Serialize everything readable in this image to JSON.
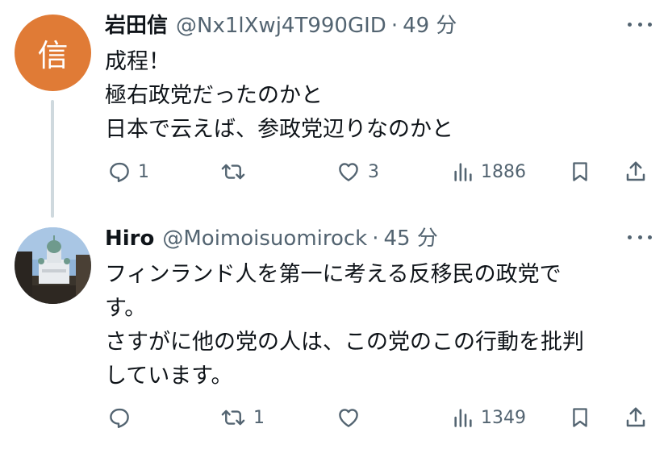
{
  "tweets": [
    {
      "display_name": "岩田信",
      "handle": "@Nx1lXwj4T990GID",
      "time": "49 分",
      "avatar": {
        "letter": "信",
        "color": "#e07b36"
      },
      "lines": [
        "成程！",
        "極右政党だったのかと",
        "日本で云えば、参政党辺りなのかと"
      ],
      "actions": {
        "replies": "1",
        "reposts": "",
        "likes": "3",
        "views": "1886"
      }
    },
    {
      "display_name": "Hiro",
      "handle": "@Moimoisuomirock",
      "time": "45 分",
      "avatar": {
        "letter": "",
        "color": "#6f8fb0"
      },
      "lines": [
        "フィンランド人を第一に考える反移民の政党で",
        "す。",
        "さすがに他の党の人は、この党のこの行動を批判",
        "しています。"
      ],
      "actions": {
        "replies": "",
        "reposts": "1",
        "likes": "",
        "views": "1349"
      }
    }
  ],
  "separator": "·",
  "icons": [
    "reply-icon",
    "repost-icon",
    "like-icon",
    "views-icon",
    "bookmark-icon",
    "share-icon",
    "more-icon"
  ],
  "colors": {
    "text": "#0f1419",
    "secondary": "#536471",
    "thread_line": "#cfd9de"
  }
}
